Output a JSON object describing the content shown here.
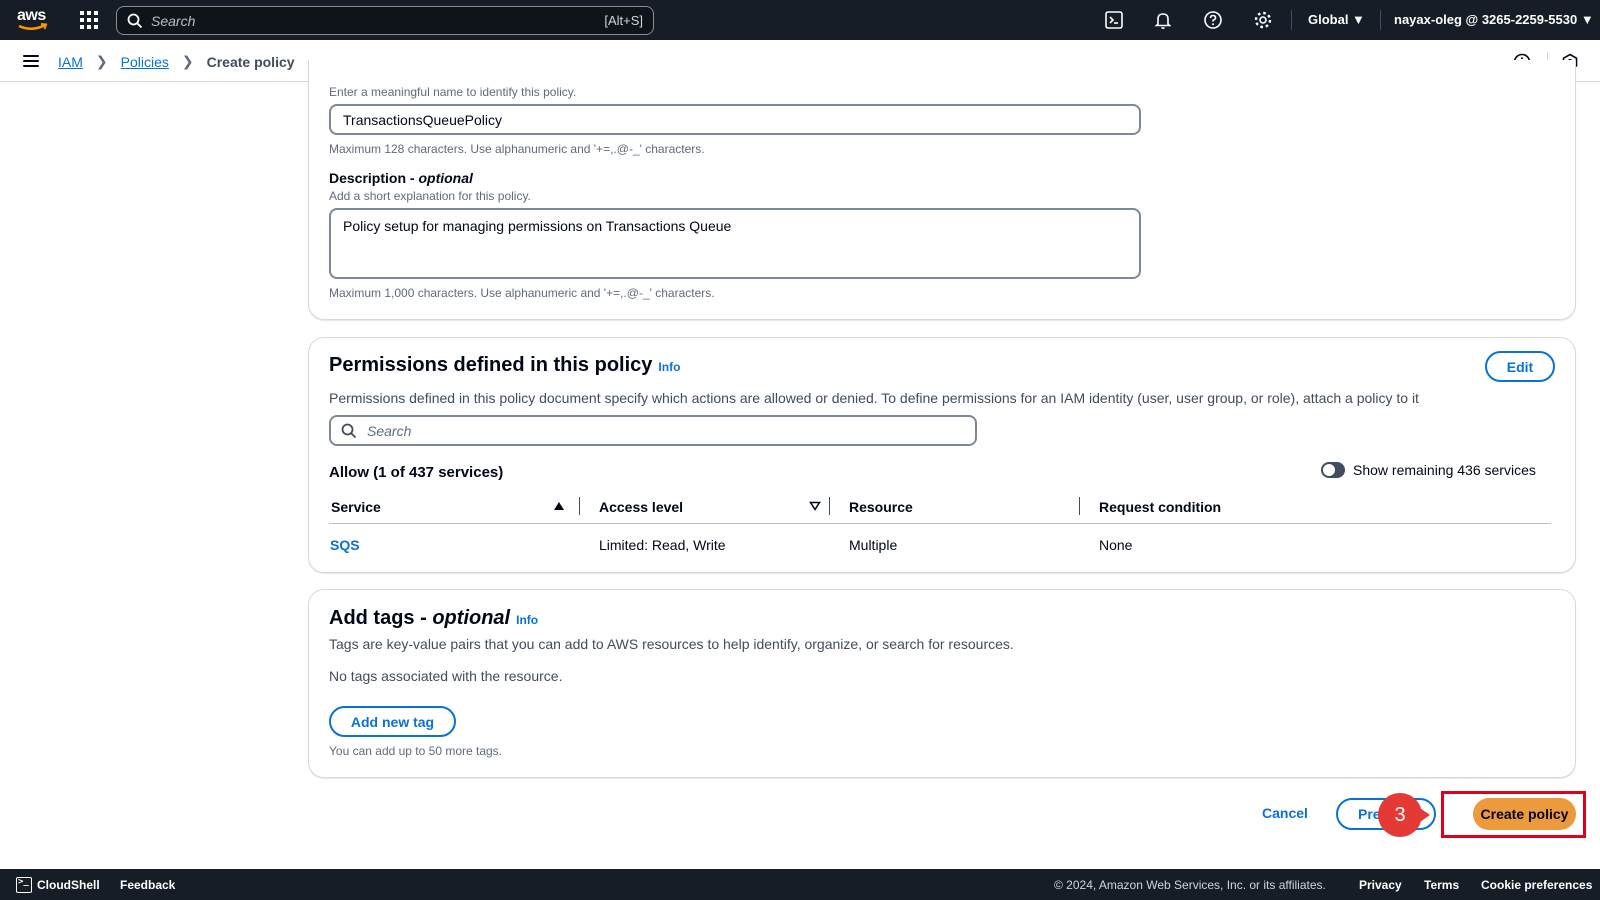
{
  "topnav": {
    "logo_text": "aws",
    "search_placeholder": "Search",
    "search_shortcut": "[Alt+S]",
    "region": "Global ▼",
    "account": "nayax-oleg @ 3265-2259-5530 ▼"
  },
  "breadcrumb": {
    "items": [
      "IAM",
      "Policies"
    ],
    "current": "Create policy"
  },
  "details": {
    "name_hint": "Enter a meaningful name to identify this policy.",
    "name_value": "TransactionsQueuePolicy",
    "name_constraint": "Maximum 128 characters. Use alphanumeric and '+=,.@-_' characters.",
    "description_label": "Description",
    "description_optional": "optional",
    "description_hint": "Add a short explanation for this policy.",
    "description_value": "Policy setup for managing permissions on Transactions Queue",
    "description_constraint": "Maximum 1,000 characters. Use alphanumeric and '+=,.@-_' characters."
  },
  "permissions": {
    "title": "Permissions defined in this policy",
    "info": "Info",
    "edit": "Edit",
    "description": "Permissions defined in this policy document specify which actions are allowed or denied. To define permissions for an IAM identity (user, user group, or role), attach a policy to it",
    "search_placeholder": "Search",
    "allow_label": "Allow (1 of 437 services)",
    "toggle_label": "Show remaining 436 services",
    "columns": [
      "Service",
      "Access level",
      "Resource",
      "Request condition"
    ],
    "rows": [
      {
        "service": "SQS",
        "access": "Limited: Read, Write",
        "resource": "Multiple",
        "condition": "None"
      }
    ]
  },
  "tags": {
    "title": "Add tags",
    "optional": "optional",
    "info": "Info",
    "description": "Tags are key-value pairs that you can add to AWS resources to help identify, organize, or search for resources.",
    "empty": "No tags associated with the resource.",
    "add_button": "Add new tag",
    "limit": "You can add up to 50 more tags."
  },
  "actions": {
    "cancel": "Cancel",
    "previous": "Previous",
    "create": "Create policy",
    "step_number": "3"
  },
  "footer": {
    "cloudshell": "CloudShell",
    "feedback": "Feedback",
    "copyright": "© 2024, Amazon Web Services, Inc. or its affiliates.",
    "privacy": "Privacy",
    "terms": "Terms",
    "cookies": "Cookie preferences"
  },
  "colors": {
    "nav_bg": "#161d26",
    "link": "#0972d3",
    "primary_button": "#ec9a3c",
    "annotation": "#e53935"
  }
}
